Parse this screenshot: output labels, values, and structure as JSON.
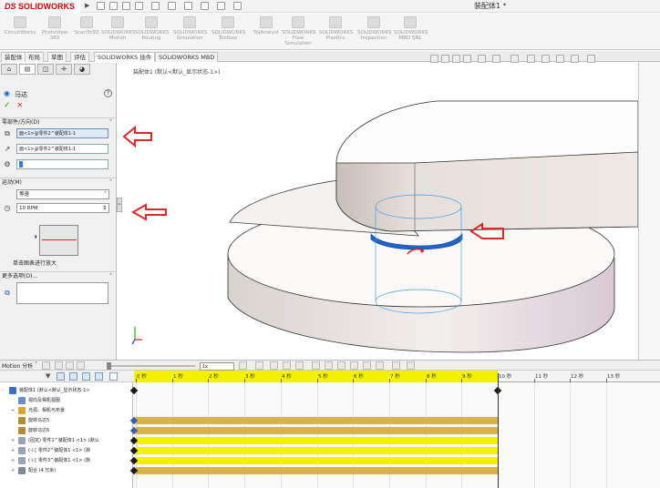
{
  "app": {
    "logo": "SOLIDWORKS",
    "logo_prefix": "DS",
    "document_title": "装配体1 *"
  },
  "command_manager": [
    "CircuitWorks",
    "PhotoView 360",
    "ScanTo3D",
    "SOLIDWORKS Motion",
    "SOLIDWORKS Routing",
    "SOLIDWORKS Simulation",
    "SOLIDWORKS Toolbox",
    "TolAnalyst",
    "SOLIDWORKS Flow Simulation",
    "SOLIDWORKS Plastics",
    "SOLIDWORKS Inspection",
    "SOLIDWORKS MBD SNL"
  ],
  "tabs": [
    {
      "label": "装配体",
      "active": false
    },
    {
      "label": "布局",
      "active": false
    },
    {
      "label": "草图",
      "active": false
    },
    {
      "label": "评估",
      "active": false
    },
    {
      "label": "SOLIDWORKS 插件",
      "active": true
    },
    {
      "label": "SOLIDWORKS MBD",
      "active": false
    }
  ],
  "property_manager": {
    "title": "马达",
    "help": "?",
    "ok": "✓",
    "cancel": "✕",
    "section_component": "零部件/方向(D)",
    "face1": "面<1>@零件2^装配体1-1",
    "face2": "面<1>@零件2^装配体1-1",
    "section_motion": "运动(M)",
    "motion_type": "等速",
    "speed": "10 RPM",
    "graph_caption": "单击图表进行放大",
    "section_more": "更多选项(O)..."
  },
  "viewport": {
    "tree_root": "装配体1 (默认<默认_显示状态-1>)"
  },
  "timeline": {
    "study_label": "Motion 分析",
    "speed_value": "1x",
    "ticks": [
      "0 秒",
      "1 秒",
      "2 秒",
      "3 秒",
      "4 秒",
      "5 秒",
      "6 秒",
      "7 秒",
      "8 秒",
      "9 秒",
      "10 秒",
      "11 秒",
      "12 秒",
      "13 秒"
    ],
    "tree_items": [
      {
        "label": "装配体1 (默认<默认_显示状态-1>",
        "expand": "-",
        "indent": 0
      },
      {
        "label": "视向及相机视图",
        "expand": "",
        "indent": 1
      },
      {
        "label": "光源、相机与布景",
        "expand": "+",
        "indent": 1
      },
      {
        "label": "旋转马达5",
        "expand": "",
        "indent": 1
      },
      {
        "label": "旋转马达6",
        "expand": "",
        "indent": 1
      },
      {
        "label": "(固定) 零件1^装配体1 <1> (默认",
        "expand": "+",
        "indent": 1
      },
      {
        "label": "(-) [ 零件2^装配体1 <1> (默",
        "expand": "+",
        "indent": 1
      },
      {
        "label": "(-) [ 零件3^装配体1 <1> (默",
        "expand": "+",
        "indent": 1
      },
      {
        "label": "配合 (4 冗余)",
        "expand": "+",
        "indent": 1
      }
    ]
  },
  "colors": {
    "accent_blue": "#1f64c8",
    "callout_red": "#d92a2a",
    "timeline_yellow": "#f4f100",
    "timeline_gold": "#d8b34a",
    "body_gray": "#e4dedb"
  }
}
